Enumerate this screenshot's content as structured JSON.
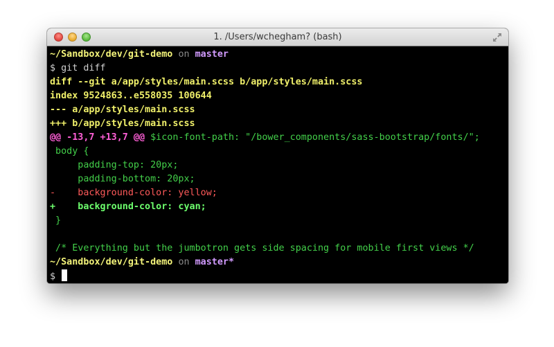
{
  "window": {
    "title": "1. /Users/wchegham? (bash)"
  },
  "prompt1": {
    "path": "~/Sandbox/dev/git-demo",
    "on": "on",
    "branch": "master"
  },
  "command": {
    "symbol": "$",
    "text": "git diff"
  },
  "diff": {
    "header_git": "diff --git a/app/styles/main.scss b/app/styles/main.scss",
    "header_index": "index 9524863..e558035 100644",
    "header_minus": "--- a/app/styles/main.scss",
    "header_plus": "+++ b/app/styles/main.scss",
    "hunk_marker": "@@ -13,7 +13,7 @@",
    "hunk_context": " $icon-font-path: \"/bower_components/sass-bootstrap/fonts/\";",
    "lines": [
      {
        "kind": "ctx",
        "text": " body {"
      },
      {
        "kind": "ctx",
        "text": "     padding-top: 20px;"
      },
      {
        "kind": "ctx",
        "text": "     padding-bottom: 20px;"
      },
      {
        "kind": "del",
        "text": "-    background-color: yellow;"
      },
      {
        "kind": "add",
        "text": "+    background-color: cyan;"
      },
      {
        "kind": "ctx",
        "text": " }"
      },
      {
        "kind": "ctx",
        "text": ""
      },
      {
        "kind": "ctx",
        "text": " /* Everything but the jumbotron gets side spacing for mobile first views */"
      }
    ]
  },
  "prompt2": {
    "path": "~/Sandbox/dev/git-demo",
    "on": "on",
    "branch": "master*"
  },
  "prompt3": {
    "symbol": "$"
  },
  "icons": {
    "close": "close-window-icon",
    "minimize": "minimize-window-icon",
    "zoom": "zoom-window-icon",
    "fullscreen": "fullscreen-arrows-icon"
  },
  "colors": {
    "background": "#000000",
    "path": "#f4f47a",
    "branch": "#d29bff",
    "hunk": "#ff5fd7",
    "context": "#43d04a",
    "deleted": "#ff5a5a",
    "added": "#6dff6d"
  }
}
